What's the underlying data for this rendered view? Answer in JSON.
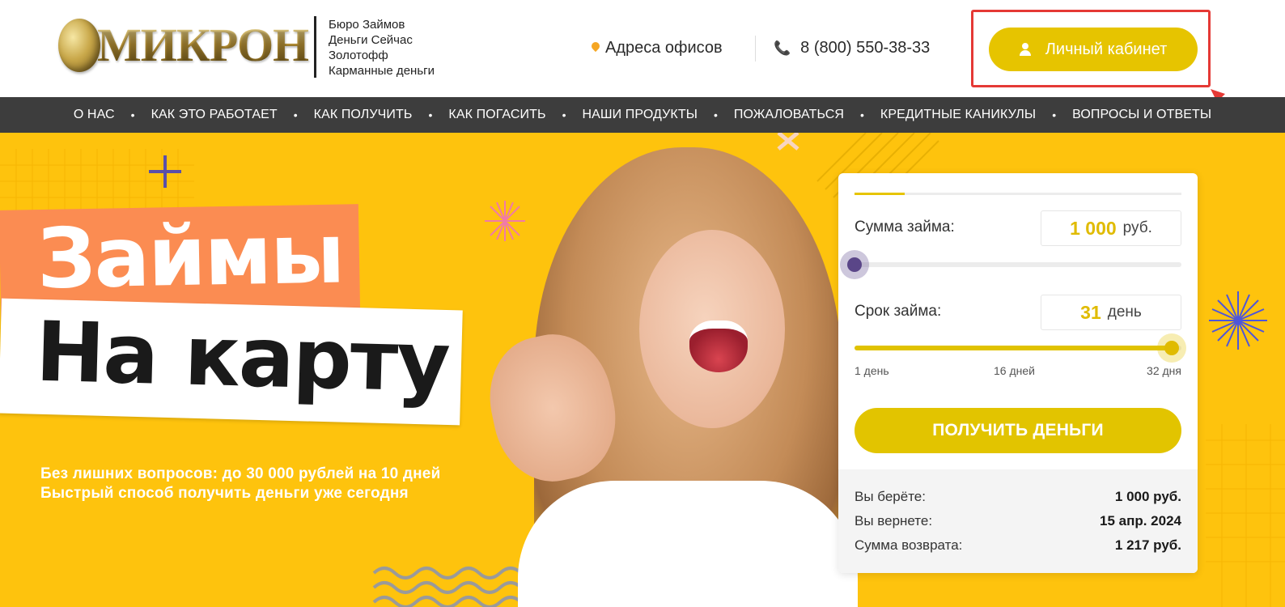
{
  "header": {
    "logo_text": "МИКРОН",
    "brands": [
      "Бюро Займов",
      "Деньги Сейчас",
      "Золотофф",
      "Карманные деньги"
    ],
    "address_link": "Адреса офисов",
    "phone": "8 (800) 550-38-33",
    "cabinet_button": "Личный кабинет"
  },
  "nav": {
    "items": [
      "О НАС",
      "КАК ЭТО РАБОТАЕТ",
      "КАК ПОЛУЧИТЬ",
      "КАК ПОГАСИТЬ",
      "НАШИ ПРОДУКТЫ",
      "ПОЖАЛОВАТЬСЯ",
      "КРЕДИТНЫЕ КАНИКУЛЫ",
      "ВОПРОСЫ И ОТВЕТЫ"
    ]
  },
  "hero": {
    "headline_1": "Займы",
    "headline_2": "На карту",
    "tagline_1": "Без лишних вопросов: до 30 000 рублей на 10 дней",
    "tagline_2": "Быстрый способ получить деньги уже сегодня"
  },
  "calculator": {
    "amount_label": "Сумма займа:",
    "amount_value": "1 000",
    "amount_unit": "руб.",
    "amount_slider_fraction": 0.0,
    "term_label": "Срок займа:",
    "term_value": "31",
    "term_unit": "день",
    "term_slider_fraction": 0.97,
    "term_ticks": [
      "1 день",
      "16 дней",
      "32 дня"
    ],
    "submit_button": "ПОЛУЧИТЬ ДЕНЬГИ",
    "summary": {
      "take_label": "Вы берёте:",
      "take_value": "1 000 руб.",
      "return_date_label": "Вы вернете:",
      "return_date_value": "15 апр. 2024",
      "return_sum_label": "Сумма возврата:",
      "return_sum_value": "1 217 руб."
    }
  },
  "colors": {
    "accent_yellow": "#e6c400",
    "hero_background": "#fec30d",
    "nav_background": "#3d3d3d",
    "banner_orange": "#fb8c52",
    "highlight_red": "#e53935"
  }
}
